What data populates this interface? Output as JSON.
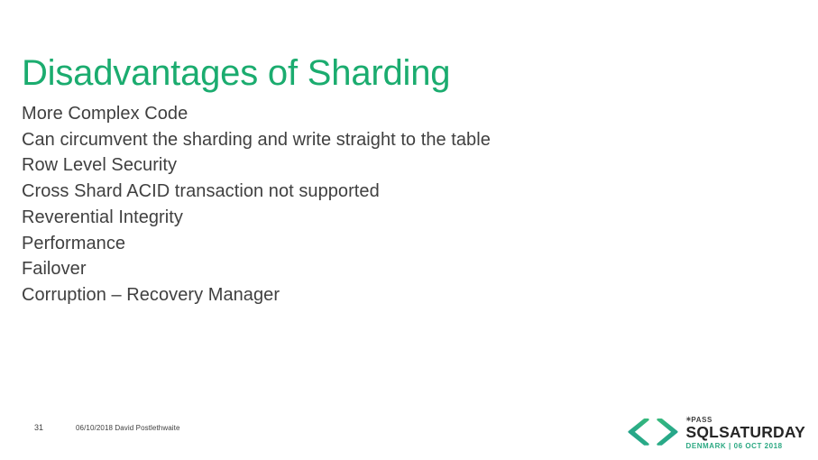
{
  "slide": {
    "title": "Disadvantages of Sharding",
    "title_color": "#1BAC6F",
    "background_color": "#FFFFFF",
    "body_text_color": "#404040",
    "bullets": [
      "More Complex Code",
      "Can circumvent the sharding and write straight to the table",
      "Row Level Security",
      "Cross Shard ACID transaction not supported",
      "Reverential Integrity",
      "Performance",
      "Failover",
      "Corruption – Recovery Manager"
    ]
  },
  "footer": {
    "page_number": "31",
    "credit": "06/10/2018 David Postlethwaite"
  },
  "logo": {
    "mark_icon": "code-chevrons-icon",
    "mark_color_left": "#2BA08C",
    "mark_color_right": "#33B47E",
    "star_glyph": "✳",
    "org": "PASS",
    "brand": "SQLSATURDAY",
    "subtitle": "DENMARK | 06 OCT 2018",
    "subtitle_color": "#2BA882"
  }
}
